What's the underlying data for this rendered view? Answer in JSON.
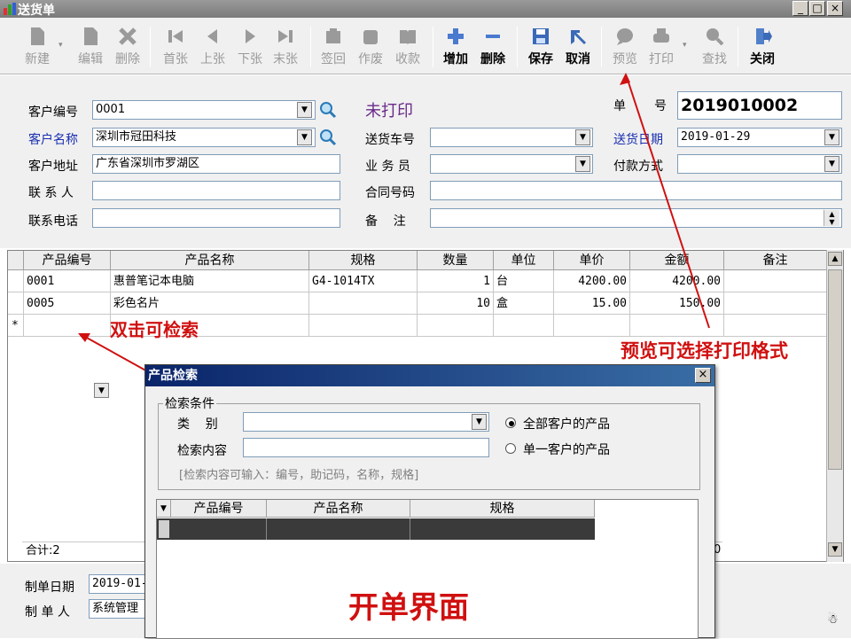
{
  "window": {
    "title": "送货单",
    "minimize": "_",
    "maximize": "□",
    "close": "×"
  },
  "toolbar": [
    {
      "label": "新建",
      "icon": "new-icon",
      "enabled": false
    },
    {
      "label": "编辑",
      "icon": "edit-icon",
      "enabled": false
    },
    {
      "label": "删除",
      "icon": "delete-icon",
      "enabled": false
    },
    {
      "label": "首张",
      "icon": "first-icon",
      "enabled": false
    },
    {
      "label": "上张",
      "icon": "previous-icon",
      "enabled": false
    },
    {
      "label": "下张",
      "icon": "next-icon",
      "enabled": false
    },
    {
      "label": "末张",
      "icon": "last-icon",
      "enabled": false
    },
    {
      "label": "签回",
      "icon": "sign-back-icon",
      "enabled": false
    },
    {
      "label": "作废",
      "icon": "void-icon",
      "enabled": false
    },
    {
      "label": "收款",
      "icon": "collect-icon",
      "enabled": false
    },
    {
      "label": "增加",
      "icon": "add-row-icon",
      "enabled": true
    },
    {
      "label": "删除",
      "icon": "remove-row-icon",
      "enabled": true
    },
    {
      "label": "保存",
      "icon": "save-icon",
      "enabled": true
    },
    {
      "label": "取消",
      "icon": "cancel-icon",
      "enabled": true
    },
    {
      "label": "预览",
      "icon": "preview-icon",
      "enabled": false
    },
    {
      "label": "打印",
      "icon": "print-icon",
      "enabled": false
    },
    {
      "label": "查找",
      "icon": "find-icon",
      "enabled": false
    },
    {
      "label": "关闭",
      "icon": "close-door-icon",
      "enabled": true
    }
  ],
  "form": {
    "customer_code_label": "客户编号",
    "customer_code": "0001",
    "customer_name_label": "客户名称",
    "customer_name": "深圳市冠田科技",
    "customer_address_label": "客户地址",
    "customer_address": "广东省深圳市罗湖区",
    "contact_label": "联 系 人",
    "contact": "",
    "phone_label": "联系电话",
    "phone": "",
    "print_status": "未打印",
    "vehicle_label": "送货车号",
    "vehicle": "",
    "salesman_label": "业 务 员",
    "salesman": "",
    "contract_label": "合同号码",
    "contract": "",
    "remark_label": "备    注",
    "remark": "",
    "order_no_label_1": "单",
    "order_no_label_2": "号",
    "order_no": "2019010002",
    "delivery_date_label": "送货日期",
    "delivery_date": "2019-01-29",
    "payment_label": "付款方式",
    "payment": ""
  },
  "grid": {
    "columns": [
      "产品编号",
      "产品名称",
      "规格",
      "数量",
      "单位",
      "单价",
      "金额",
      "备注"
    ],
    "rows": [
      {
        "code": "0001",
        "name": "惠普笔记本电脑",
        "spec": "G4-1014TX",
        "qty": "1",
        "unit": "台",
        "price": "4200.00",
        "amount": "4200.00",
        "note": ""
      },
      {
        "code": "0005",
        "name": "彩色名片",
        "spec": "",
        "qty": "10",
        "unit": "盒",
        "price": "15.00",
        "amount": "150.00",
        "note": ""
      }
    ],
    "new_row_marker": "*",
    "total_label": "合计:2",
    "total_tail": "0"
  },
  "bottom": {
    "created_date_label": "制单日期",
    "created_date": "2019-01-",
    "creator_label": "制 单 人",
    "creator": "系统管理"
  },
  "dialog": {
    "title": "产品检索",
    "close": "×",
    "group_title": "检索条件",
    "category_label": "类    别",
    "category": "",
    "search_label": "检索内容",
    "search_value": "",
    "radio_all": "全部客户的产品",
    "radio_single": "单一客户的产品",
    "hint": "[检索内容可输入：编号，助记码，名称，规格]",
    "columns": [
      "产品编号",
      "产品名称",
      "规格"
    ]
  },
  "annotations": {
    "double_click": "双击可检索",
    "preview_tip": "预览可选择打印格式",
    "open_screen": "开单界面"
  },
  "colors": {
    "annotation": "#d01010",
    "label_blue": "#1a2fb0",
    "print_status": "#6a2a8a",
    "dialog_title": "#0a246a"
  }
}
